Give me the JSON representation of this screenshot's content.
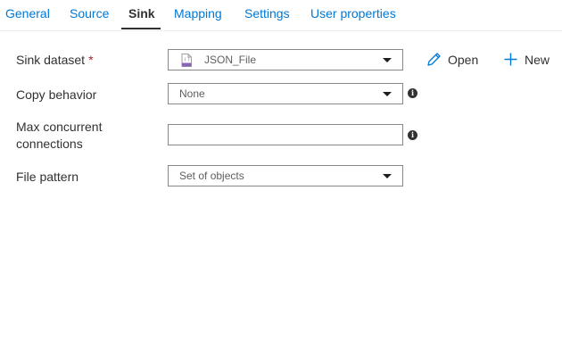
{
  "tabs": [
    {
      "label": "General"
    },
    {
      "label": "Source"
    },
    {
      "label": "Sink"
    },
    {
      "label": "Mapping"
    },
    {
      "label": "Settings"
    },
    {
      "label": "User properties"
    }
  ],
  "active_tab": "Sink",
  "form": {
    "sink_dataset": {
      "label": "Sink dataset",
      "required_mark": "*",
      "value": "JSON_File"
    },
    "copy_behavior": {
      "label": "Copy behavior",
      "value": "None"
    },
    "max_concurrent": {
      "label_line1": "Max concurrent",
      "label_line2": "connections",
      "value": ""
    },
    "file_pattern": {
      "label": "File pattern",
      "value": "Set of objects"
    }
  },
  "actions": {
    "open_label": "Open",
    "new_label": "New"
  },
  "icons": {
    "edit": "pencil-icon",
    "add": "plus-icon",
    "info": "info-icon",
    "dataset": "json-file-icon",
    "dropdown": "chevron-down-icon"
  },
  "colors": {
    "link_blue": "#0078d4",
    "required_red": "#a4262c",
    "dataset_icon_purple": "#8764b8"
  }
}
